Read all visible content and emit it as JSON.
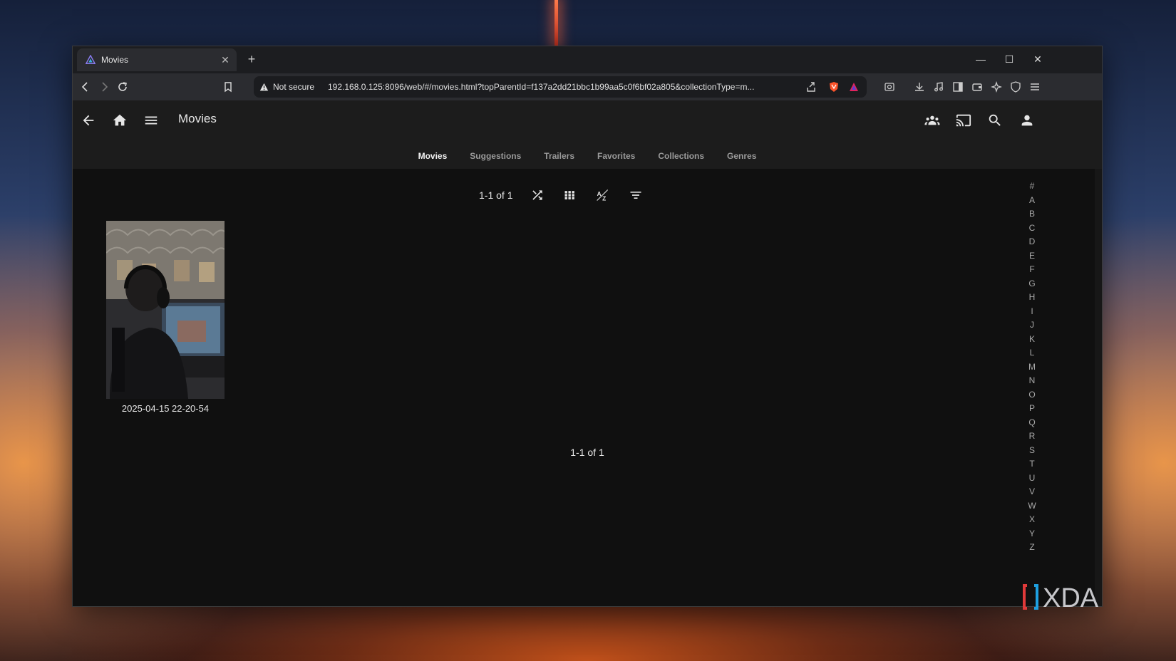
{
  "browser": {
    "tab_title": "Movies",
    "not_secure_label": "Not secure",
    "url": "192.168.0.125:8096/web/#/movies.html?topParentId=f137a2dd21bbc1b99aa5c0f6bf02a805&collectionType=m...",
    "brave_badge": "1"
  },
  "header": {
    "title": "Movies"
  },
  "tabs": [
    {
      "label": "Movies",
      "active": true
    },
    {
      "label": "Suggestions"
    },
    {
      "label": "Trailers"
    },
    {
      "label": "Favorites"
    },
    {
      "label": "Collections"
    },
    {
      "label": "Genres"
    }
  ],
  "controls": {
    "count_label": "1-1 of 1"
  },
  "items": [
    {
      "title": "2025-04-15 22-20-54"
    }
  ],
  "pager_bottom": "1-1 of 1",
  "alphabet": [
    "#",
    "A",
    "B",
    "C",
    "D",
    "E",
    "F",
    "G",
    "H",
    "I",
    "J",
    "K",
    "L",
    "M",
    "N",
    "O",
    "P",
    "Q",
    "R",
    "S",
    "T",
    "U",
    "V",
    "W",
    "X",
    "Y",
    "Z"
  ],
  "watermark": "XDA",
  "colors": {
    "accent": "#00a4dc",
    "background": "#101010",
    "header": "#1c1c1c"
  }
}
